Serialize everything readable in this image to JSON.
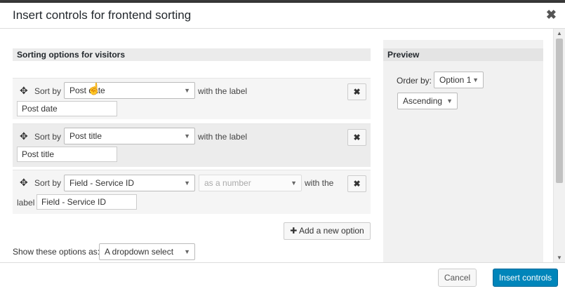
{
  "dialog": {
    "title": "Insert controls for frontend sorting",
    "close_glyph": "✖"
  },
  "sorting": {
    "section_title": "Sorting options for visitors",
    "rows": [
      {
        "sort_by_label": "Sort by",
        "sort_field": "Post date",
        "with_label": "with the label",
        "label_value": "Post date"
      },
      {
        "sort_by_label": "Sort by",
        "sort_field": "Post title",
        "with_label": "with the label",
        "label_value": "Post title"
      },
      {
        "sort_by_label": "Sort by",
        "sort_field": "Field - Service ID",
        "sort_as": "as a number",
        "with_label_part1": "with the",
        "with_label_part2": "label",
        "label_value": "Field - Service ID"
      }
    ],
    "add_button": "✚ Add a new option",
    "show_as_label": "Show these options as:",
    "show_as_value": "A dropdown select"
  },
  "preview": {
    "title": "Preview",
    "order_by_label": "Order by:",
    "order_by_value": "Option 1",
    "direction_value": "Ascending"
  },
  "footer": {
    "cancel_label": "Cancel",
    "insert_label": "Insert controls"
  },
  "colors": {
    "primary": "#0085ba",
    "panel_bg": "#f1f1f1",
    "row_bg": "#f5f5f5"
  }
}
